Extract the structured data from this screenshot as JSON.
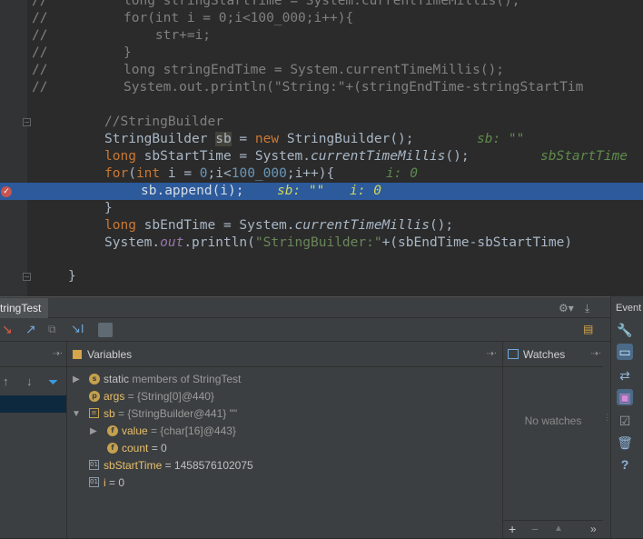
{
  "editor": {
    "lines": [
      {
        "comment": "//",
        "code": "long stringStartTime = System.currentTimeMillis();"
      },
      {
        "comment": "//",
        "code": "for(int i = 0;i<100_000;i++){"
      },
      {
        "comment": "//",
        "code": "    str+=i;"
      },
      {
        "comment": "//",
        "code": "}"
      },
      {
        "comment": "//",
        "code": "long stringEndTime = System.currentTimeMillis();"
      },
      {
        "comment": "//",
        "code": "System.out.println(\"String:\"+(stringEndTime-stringStartTim"
      }
    ],
    "sb_comment": "//StringBuilder",
    "decl_type": "StringBuilder",
    "decl_var": "sb",
    "decl_eq": " = ",
    "decl_new": "new",
    "decl_ctor": " StringBuilder();",
    "decl_inline": "sb: \"\"",
    "start_kw": "long",
    "start_mid": " sbStartTime = System.",
    "start_method": "currentTimeMillis",
    "start_end": "();",
    "start_inline": "sbStartTime",
    "for_kw": "for",
    "for_int": "int",
    "for_a": "(",
    "for_b": " i = ",
    "for_zero": "0",
    "for_c": ";i<",
    "for_num": "100_000",
    "for_d": ";i++){",
    "for_inline": "i: 0",
    "append_code": "sb.append(i);",
    "append_inline_sb": "sb: \"\"",
    "append_inline_i": "i: 0",
    "close_brace": "}",
    "end_kw": "long",
    "end_mid": " sbEndTime = System.",
    "end_method": "currentTimeMillis",
    "end_end": "();",
    "print_a": "System.",
    "print_out": "out",
    "print_b": ".println(",
    "print_str": "\"StringBuilder:\"",
    "print_c": "+(sbEndTime-sbStartTime)",
    "class_close": "}"
  },
  "debug": {
    "tab_label": "tringTest",
    "frames_header": "",
    "variables_header": "Variables",
    "watches_header": "Watches",
    "no_watches": "No watches",
    "variables": [
      {
        "badge": "s",
        "name": "static",
        "rest": " members of StringTest"
      },
      {
        "badge": "p",
        "name": "args",
        "rest": " = {String[0]@440}"
      },
      {
        "badge": "",
        "name": "sb",
        "rest": " = {StringBuilder@441} \"\""
      },
      {
        "badge": "f",
        "name": "value",
        "rest": " = {char[16]@443}"
      },
      {
        "badge": "f",
        "name": "count",
        "rest": " = 0"
      },
      {
        "badge": "",
        "name": "sbStartTime",
        "rest": " = 1458576102075"
      },
      {
        "badge": "",
        "name": "i",
        "rest": " = 0"
      }
    ],
    "watch_buttons": [
      "+",
      "−",
      "▲",
      "»"
    ]
  },
  "right_panel": {
    "label": "Event"
  },
  "colors": {
    "editor_bg": "#2b2b2b",
    "highlight": "#2c5a9b",
    "keyword": "#cc7832",
    "panel_bg": "#3c3f41"
  }
}
